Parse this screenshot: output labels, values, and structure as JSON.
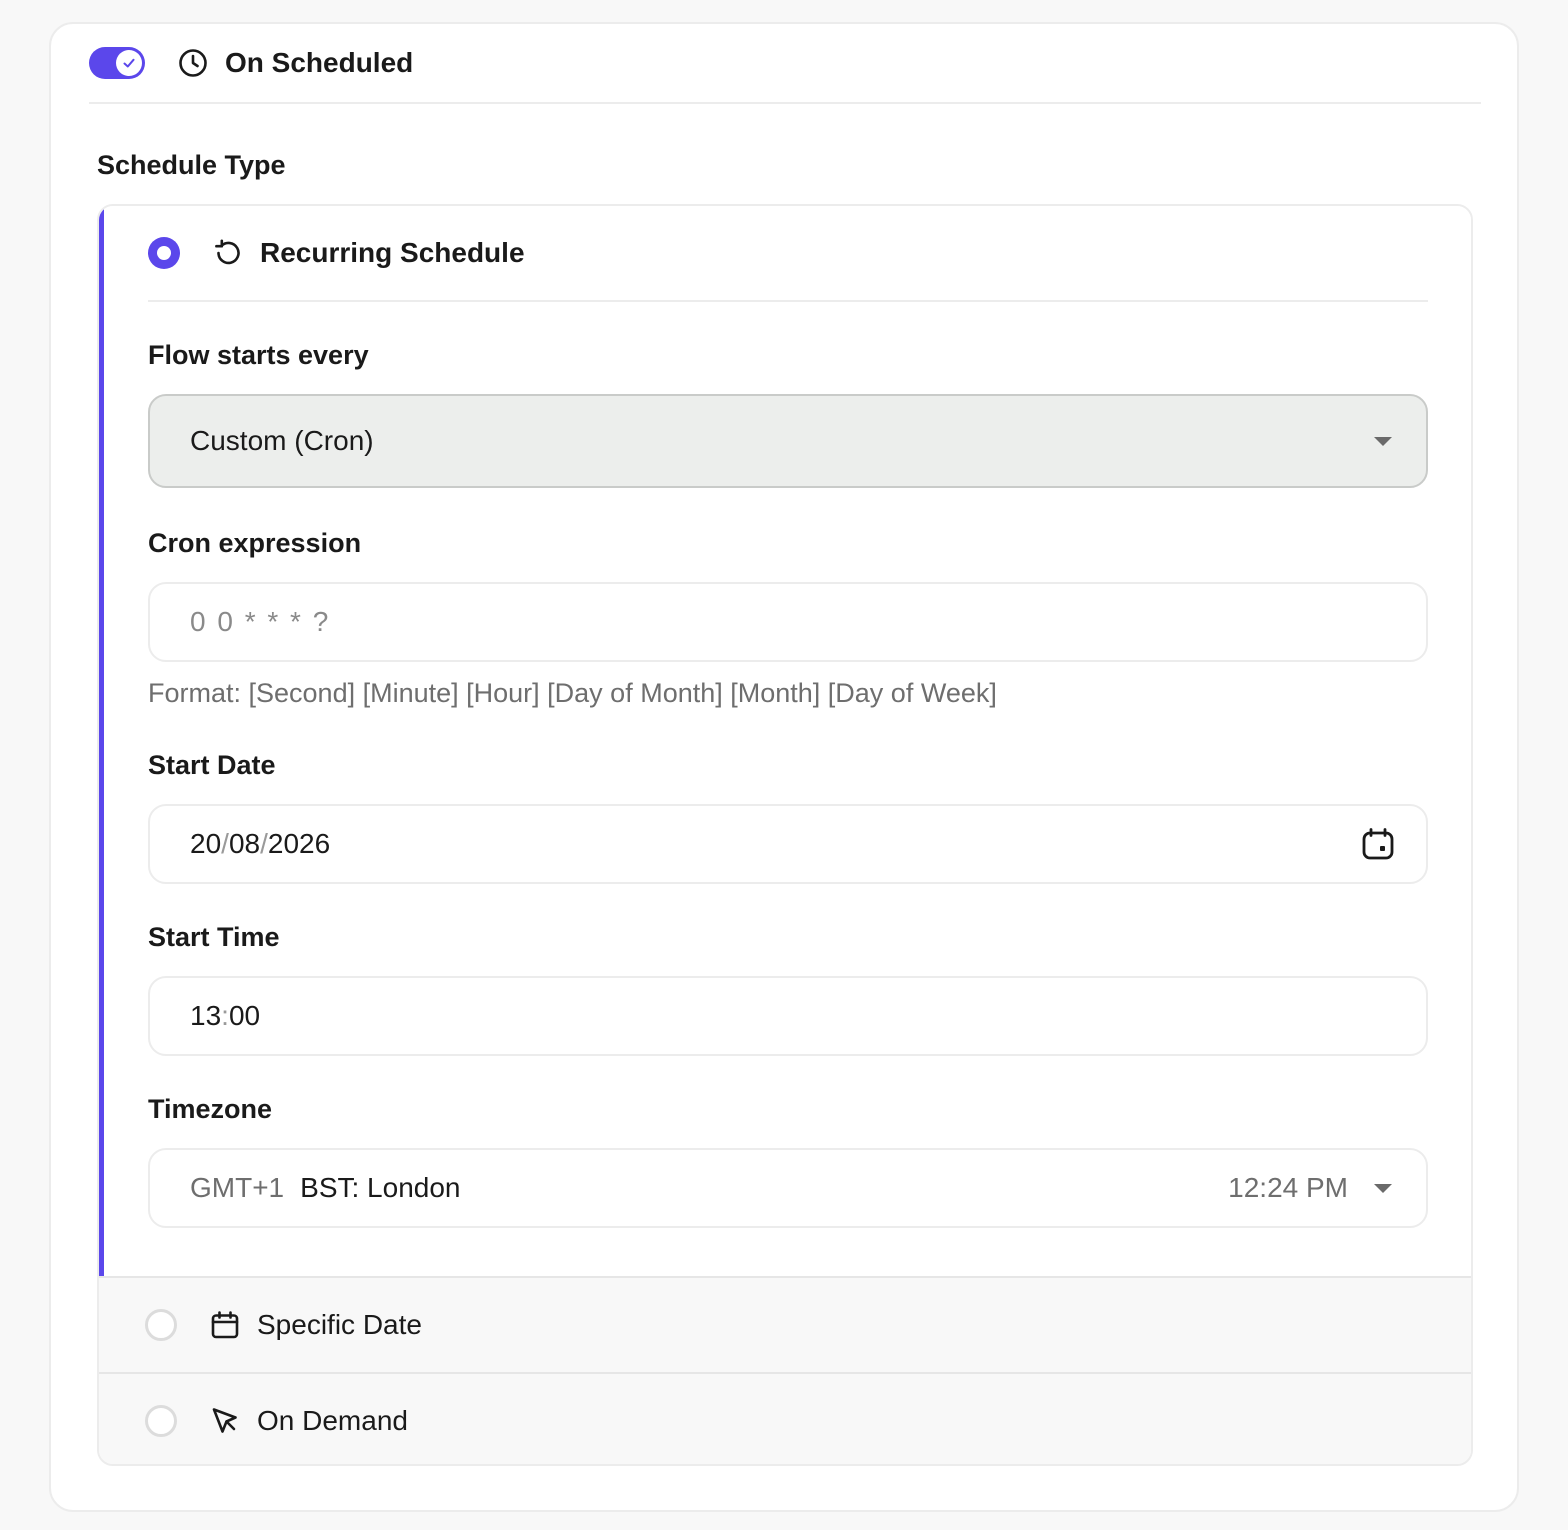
{
  "header": {
    "toggle_on": true,
    "title": "On Scheduled",
    "icon": "clock-icon"
  },
  "schedule_type": {
    "label": "Schedule Type",
    "options": [
      {
        "label": "Recurring Schedule",
        "icon": "refresh-icon",
        "selected": true
      },
      {
        "label": "Specific Date",
        "icon": "calendar-icon",
        "selected": false
      },
      {
        "label": "On Demand",
        "icon": "cursor-click-icon",
        "selected": false
      }
    ]
  },
  "recurring": {
    "flow_starts_label": "Flow starts every",
    "flow_starts_value": "Custom (Cron)",
    "cron_label": "Cron expression",
    "cron_placeholder": "0 0 * * * ?",
    "cron_hint": "Format: [Second] [Minute] [Hour] [Day of Month] [Month] [Day of Week]",
    "start_date_label": "Start Date",
    "start_date": {
      "day": "20",
      "month": "08",
      "year": "2026",
      "sep": "/"
    },
    "start_time_label": "Start Time",
    "start_time": {
      "hour": "13",
      "minute": "00",
      "sep": ":"
    },
    "timezone_label": "Timezone",
    "timezone": {
      "offset": "GMT+1",
      "name": "BST: London",
      "local_time": "12:24 PM"
    }
  },
  "colors": {
    "accent": "#5b47eb",
    "border": "#ececec",
    "select_bg": "#eceeec",
    "muted_text": "#6e6e6e"
  }
}
